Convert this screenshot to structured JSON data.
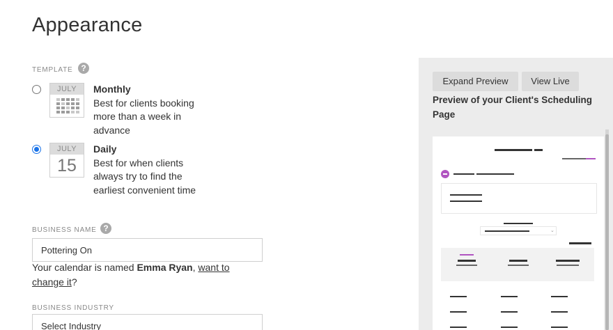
{
  "page": {
    "title": "Appearance"
  },
  "template_section": {
    "label": "TEMPLATE",
    "help": "?",
    "options": [
      {
        "calendar_month": "JULY",
        "title": "Monthly",
        "description": "Best for clients booking more than a week in advance",
        "selected": false
      },
      {
        "calendar_month": "JULY",
        "calendar_day": "15",
        "title": "Daily",
        "description": "Best for when clients always try to find the earliest convenient time",
        "selected": true
      }
    ]
  },
  "business_name": {
    "label": "BUSINESS NAME",
    "help": "?",
    "value": "Pottering On",
    "note_prefix": "Your calendar is named ",
    "calendar_owner": "Emma Ryan",
    "note_sep": ", ",
    "link_text": "want to change it",
    "note_suffix": "?"
  },
  "business_industry": {
    "label": "BUSINESS INDUSTRY",
    "value": "Select Industry"
  },
  "preview": {
    "expand_button": "Expand Preview",
    "view_live_button": "View Live",
    "caption": "Preview of your Client's Scheduling Page"
  },
  "colors": {
    "accent": "#b054c0",
    "radio_selected": "#1a73e8",
    "panel_bg": "#ececec"
  },
  "icons": {
    "help": "question-circle-icon",
    "calendar_monthly": "calendar-grid-icon",
    "calendar_daily": "calendar-day-icon"
  }
}
